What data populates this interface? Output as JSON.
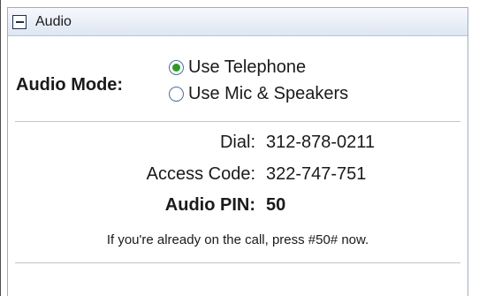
{
  "panel": {
    "title": "Audio",
    "collapse_icon": "minus-icon"
  },
  "audio_mode": {
    "label": "Audio Mode:",
    "options": [
      {
        "label": "Use Telephone",
        "selected": true
      },
      {
        "label": "Use Mic & Speakers",
        "selected": false
      }
    ],
    "selected_color": "#2f9a2a"
  },
  "dial_info": {
    "dial_label": "Dial:",
    "dial_value": "312-878-0211",
    "access_label": "Access Code:",
    "access_value": "322-747-751",
    "pin_label": "Audio PIN:",
    "pin_value": "50"
  },
  "note": "If you're already on the call, press #50# now."
}
